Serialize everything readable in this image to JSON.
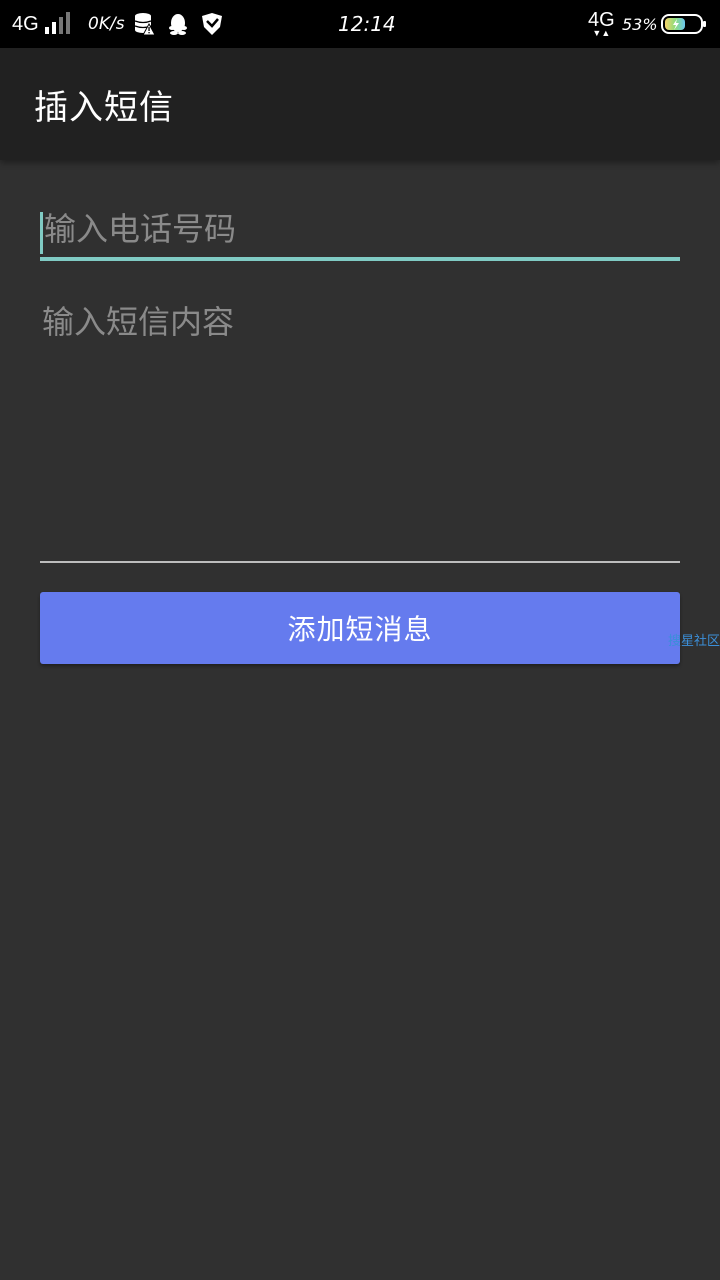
{
  "status_bar": {
    "network": "4G",
    "speed": "0K/s",
    "time": "12:14",
    "network_right": "4G",
    "battery_percent": "53%"
  },
  "app_bar": {
    "title": "插入短信"
  },
  "form": {
    "phone_placeholder": "输入电话号码",
    "message_placeholder": "输入短信内容",
    "add_button_label": "添加短消息"
  },
  "watermark": "搜星社区",
  "colors": {
    "accent": "#80cbc4",
    "button": "#657bee",
    "background": "#303030",
    "app_bar": "#212121"
  },
  "icons": [
    "signal-bars-icon",
    "database-warning-icon",
    "qq-penguin-icon",
    "shield-check-icon",
    "battery-charging-icon"
  ]
}
